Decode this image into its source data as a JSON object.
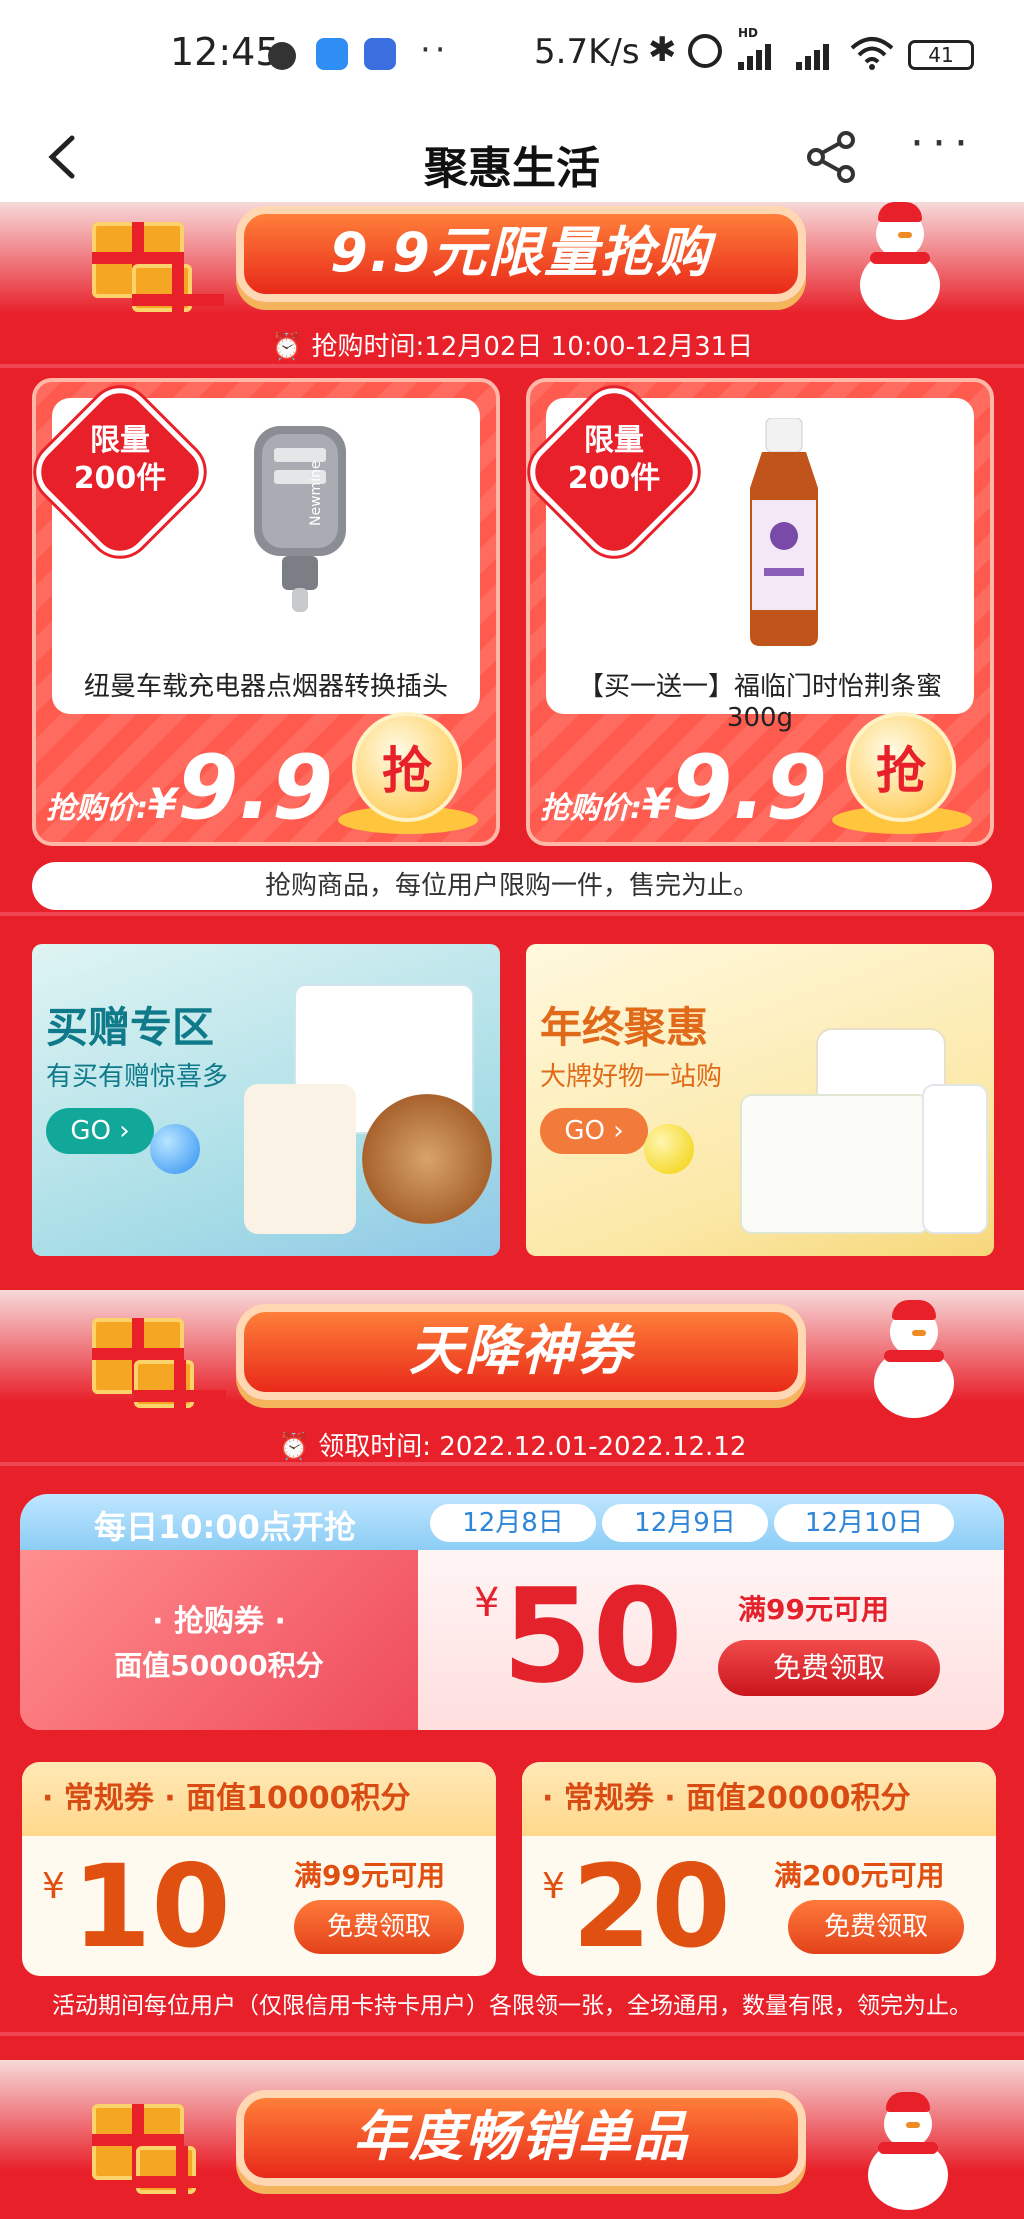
{
  "status_bar": {
    "time": "12:45",
    "more": "··",
    "speed": "5.7K/s",
    "hd": "HD",
    "battery": "41"
  },
  "nav": {
    "title": "聚惠生活"
  },
  "flash_sale": {
    "title": "9.9元限量抢购",
    "time": "⏰ 抢购时间:12月02日 10:00-12月31日",
    "products": [
      {
        "badge_line1": "限量",
        "badge_line2": "200件",
        "name": "纽曼车载充电器点烟器转换插头",
        "price_label": "抢购价:",
        "currency": "¥",
        "price": "9.9",
        "grab": "抢",
        "brand_text": "Newmine"
      },
      {
        "badge_line1": "限量",
        "badge_line2": "200件",
        "name": "【买一送一】福临门时怡荆条蜜300g",
        "price_label": "抢购价:",
        "currency": "¥",
        "price": "9.9",
        "grab": "抢"
      }
    ],
    "notice": "抢购商品，每位用户限购一件，售完为止。"
  },
  "promos": [
    {
      "title": "买赠专区",
      "subtitle": "有买有赠惊喜多",
      "go": "GO ›",
      "color": "#11a89a"
    },
    {
      "title": "年终聚惠",
      "subtitle": "大牌好物一站购",
      "go": "GO ›",
      "color": "#f27a3a"
    }
  ],
  "coupons": {
    "title": "天降神券",
    "time": "⏰ 领取时间: 2022.12.01-2022.12.12",
    "daily_label": "每日10:00点开抢",
    "dates": [
      "12月8日",
      "12月9日",
      "12月10日"
    ],
    "big": {
      "name": "· 抢购券 ·",
      "points": "面值50000积分",
      "currency": "¥",
      "amount": "50",
      "condition": "满99元可用",
      "button": "免费领取"
    },
    "small": [
      {
        "name": "· 常规券 · 面值10000积分",
        "currency": "¥",
        "amount": "10",
        "condition": "满99元可用",
        "button": "免费领取"
      },
      {
        "name": "· 常规券 · 面值20000积分",
        "currency": "¥",
        "amount": "20",
        "condition": "满200元可用",
        "button": "免费领取"
      }
    ],
    "footnote": "活动期间每位用户（仅限信用卡持卡用户）各限领一张，全场通用，数量有限，领完为止。"
  },
  "bestsellers": {
    "title": "年度畅销单品"
  },
  "colors": {
    "page_bg": "#e8202a",
    "accent_orange": "#e05010",
    "coupon_red": "#e3222c"
  }
}
